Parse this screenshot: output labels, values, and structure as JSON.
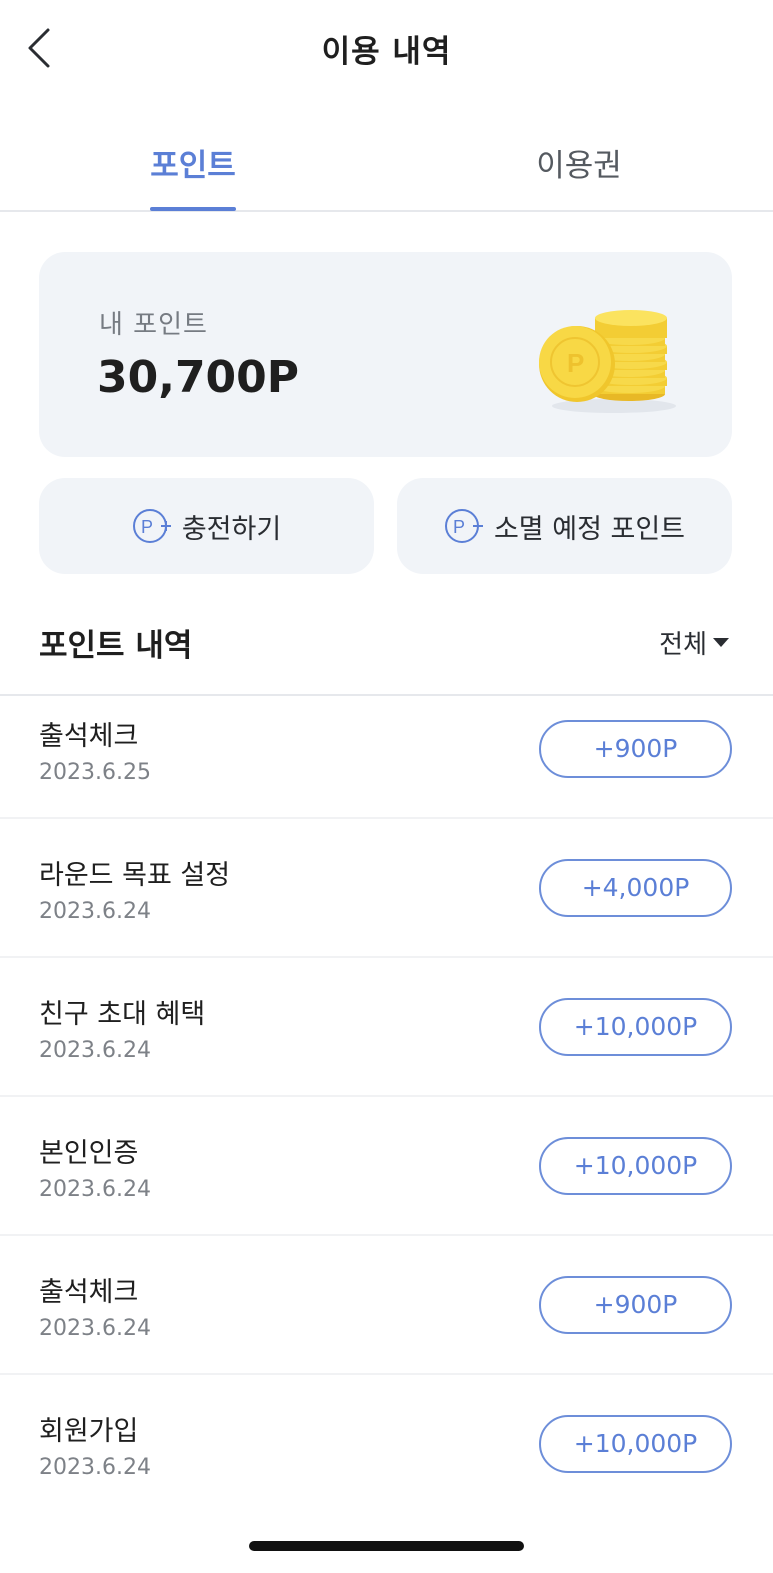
{
  "header": {
    "title": "이용 내역"
  },
  "tabs": [
    {
      "label": "포인트",
      "active": true
    },
    {
      "label": "이용권",
      "active": false
    }
  ],
  "balance": {
    "label": "내 포인트",
    "value": "30,700P"
  },
  "actions": [
    {
      "label": "충전하기",
      "icon": "point-plus-icon"
    },
    {
      "label": "소멸 예정 포인트",
      "icon": "point-minus-icon"
    }
  ],
  "history": {
    "title": "포인트 내역",
    "filter": "전체",
    "items": [
      {
        "title": "출석체크",
        "date": "2023.6.25",
        "amount": "+900P"
      },
      {
        "title": "라운드 목표 설정",
        "date": "2023.6.24",
        "amount": "+4,000P"
      },
      {
        "title": "친구 초대 혜택",
        "date": "2023.6.24",
        "amount": "+10,000P"
      },
      {
        "title": "본인인증",
        "date": "2023.6.24",
        "amount": "+10,000P"
      },
      {
        "title": "출석체크",
        "date": "2023.6.24",
        "amount": "+900P"
      },
      {
        "title": "회원가입",
        "date": "2023.6.24",
        "amount": "+10,000P"
      }
    ]
  },
  "colors": {
    "accent": "#5b7fd6",
    "card": "#f1f4f8",
    "coin": "#f5d63c"
  }
}
